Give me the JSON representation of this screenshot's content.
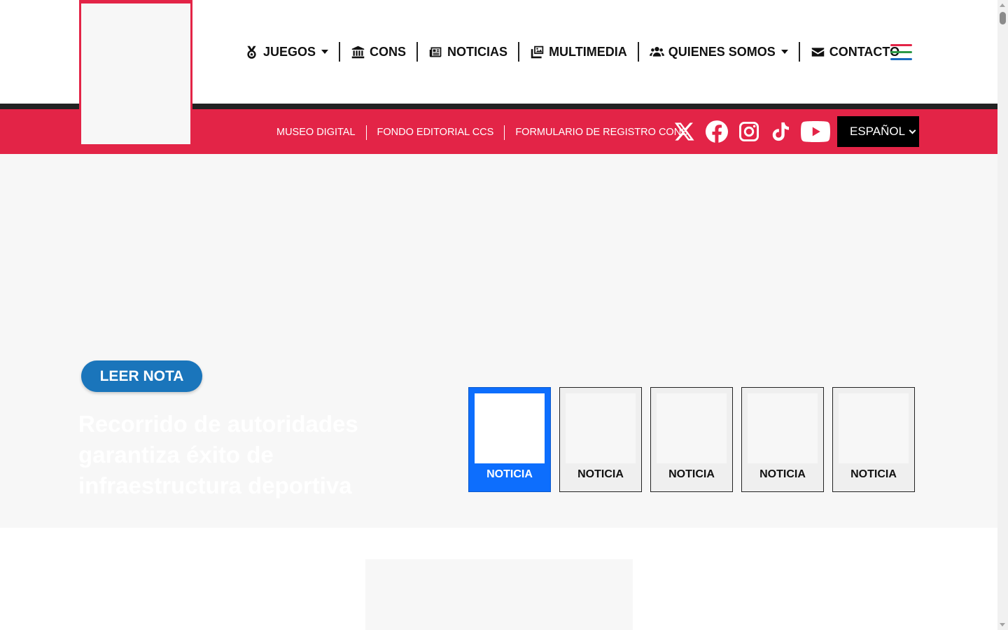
{
  "header": {
    "nav": [
      {
        "label": "JUEGOS",
        "icon": "medal-icon",
        "dropdown": true
      },
      {
        "label": "CONS",
        "icon": "institution-icon",
        "dropdown": false
      },
      {
        "label": "NOTICIAS",
        "icon": "newspaper-icon",
        "dropdown": false
      },
      {
        "label": "MULTIMEDIA",
        "icon": "photos-icon",
        "dropdown": false
      },
      {
        "label": "QUIENES SOMOS",
        "icon": "users-icon",
        "dropdown": true
      },
      {
        "label": "CONTACTO",
        "icon": "envelope-icon",
        "dropdown": false
      }
    ],
    "menu_icon": "hamburger-icon"
  },
  "subnav": {
    "links": [
      "MUSEO DIGITAL",
      "FONDO EDITORIAL CCS",
      "FORMULARIO DE REGISTRO CONS"
    ]
  },
  "social": [
    "x-icon",
    "facebook-icon",
    "instagram-icon",
    "tiktok-icon",
    "youtube-icon"
  ],
  "language": {
    "selected": "ESPAÑOL"
  },
  "hero": {
    "button_label": "LEER NOTA",
    "title": "Recorrido de autoridades garantiza éxito de infraestructura deportiva",
    "thumbnails": [
      "NOTICIA",
      "NOTICIA",
      "NOTICIA",
      "NOTICIA",
      "NOTICIA"
    ]
  },
  "colors": {
    "brand_red": "#e32447",
    "accent_blue": "#1a75bb",
    "active_blue": "#0d6efd"
  }
}
